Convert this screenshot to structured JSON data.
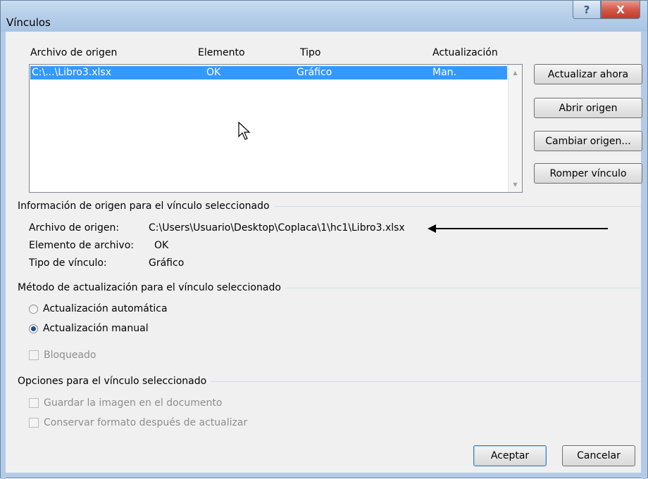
{
  "window": {
    "title": "Vínculos",
    "help_label": "?",
    "close_label": "X"
  },
  "links_list": {
    "columns": {
      "source_file": "Archivo de origen",
      "item": "Elemento",
      "type": "Tipo",
      "update": "Actualización"
    },
    "rows": [
      {
        "source_file": "C:\\...\\Libro3.xlsx",
        "item": "OK",
        "type": "Gráfico",
        "update": "Man."
      }
    ]
  },
  "side_buttons": {
    "update_now": "Actualizar ahora",
    "open_source": "Abrir origen",
    "change_source": "Cambiar origen...",
    "break_link": "Romper vínculo"
  },
  "source_info": {
    "section_title": "Información de origen para el vínculo seleccionado",
    "file_label": "Archivo de origen:",
    "file_value": "C:\\Users\\Usuario\\Desktop\\Coplaca\\1\\hc1\\Libro3.xlsx",
    "item_label": "Elemento de archivo:",
    "item_value": "OK",
    "type_label": "Tipo de vínculo:",
    "type_value": "Gráfico"
  },
  "update_method": {
    "section_title": "Método de actualización para el vínculo seleccionado",
    "automatic_label": "Actualización automática",
    "manual_label": "Actualización manual",
    "selected": "manual",
    "locked_label": "Bloqueado",
    "locked_checked": false
  },
  "link_options": {
    "section_title": "Opciones para el vínculo seleccionado",
    "save_image_label": "Guardar la imagen en el documento",
    "save_image_checked": false,
    "keep_format_label": "Conservar formato después de actualizar",
    "keep_format_checked": false
  },
  "footer": {
    "ok_label": "Aceptar",
    "cancel_label": "Cancelar"
  },
  "colors": {
    "selection": "#3399ff",
    "titlebar": "#b7cfe9",
    "close_button": "#c23a2a"
  }
}
